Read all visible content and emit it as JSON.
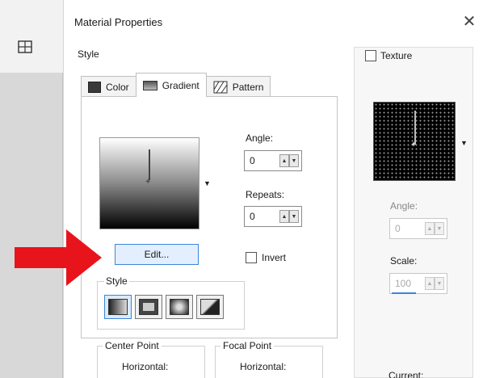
{
  "dialog": {
    "title": "Material Properties",
    "close_glyph": "✕"
  },
  "style_section": {
    "label": "Style"
  },
  "tabs": [
    {
      "label": "Color",
      "icon": "color-swatch-icon",
      "active": false
    },
    {
      "label": "Gradient",
      "icon": "gradient-icon",
      "active": true
    },
    {
      "label": "Pattern",
      "icon": "pattern-icon",
      "active": false
    }
  ],
  "gradient": {
    "angle_label": "Angle:",
    "angle_value": "0",
    "repeats_label": "Repeats:",
    "repeats_value": "0",
    "edit_label": "Edit...",
    "invert_label": "Invert",
    "invert_checked": false,
    "style_group_label": "Style",
    "style_buttons": [
      "linear-style-icon",
      "rectangular-style-icon",
      "sunburst-style-icon",
      "radial-style-icon"
    ],
    "center_point_label": "Center Point",
    "center_horizontal_label": "Horizontal:",
    "focal_point_label": "Focal Point",
    "focal_horizontal_label": "Horizontal:"
  },
  "texture": {
    "label": "Texture",
    "checked": false,
    "angle_label": "Angle:",
    "angle_value": "0",
    "scale_label": "Scale:",
    "scale_value": "100",
    "current_label": "Current:"
  },
  "colors": {
    "accent": "#3a86d8",
    "arrow": "#e8141c"
  }
}
